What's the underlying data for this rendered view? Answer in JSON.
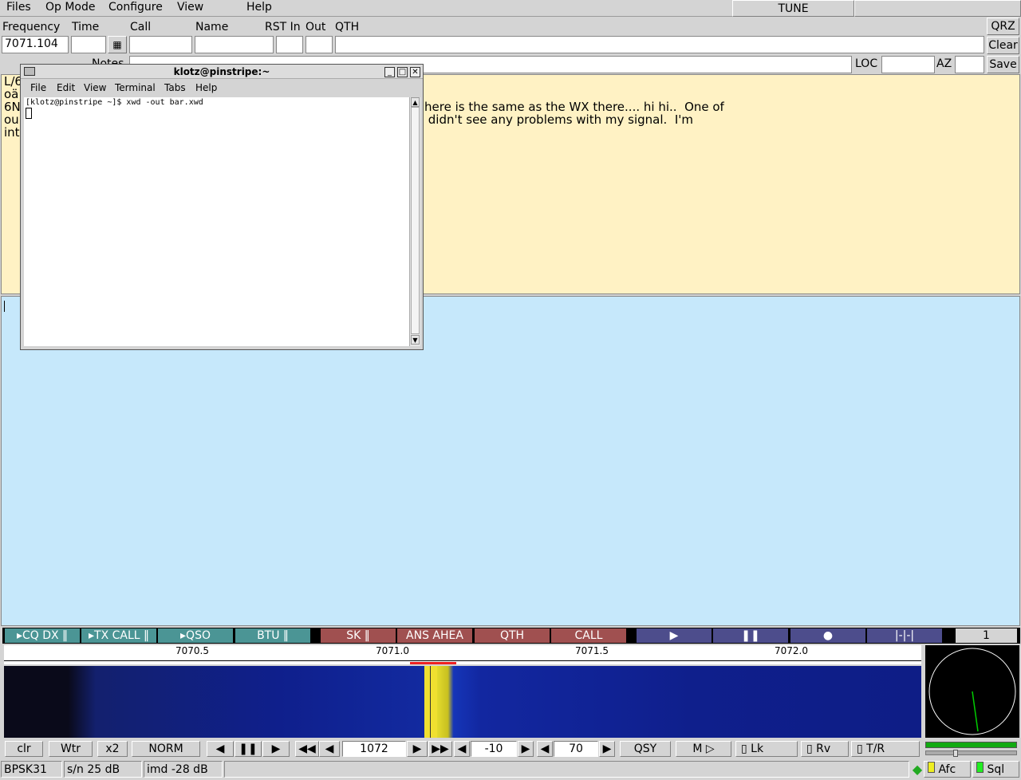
{
  "menubar": {
    "items": [
      "Files",
      "Op Mode",
      "Configure",
      "View",
      "Help"
    ],
    "tune": "TUNE"
  },
  "log": {
    "labels": {
      "frequency": "Frequency",
      "time": "Time",
      "call": "Call",
      "name": "Name",
      "rst_in": "RST In",
      "out": "Out",
      "qth": "QTH",
      "notes": "Notes",
      "loc": "LOC",
      "az": "AZ"
    },
    "frequency_value": "7071.104",
    "buttons": {
      "qrz": "QRZ",
      "clear": "Clear",
      "save": "Save"
    }
  },
  "rx_text": {
    "lines_left": [
      "L/6",
      "oä",
      "6N",
      "ou",
      "int"
    ],
    "line1": "here is the same as the WX there.... hi hi..  One of",
    "line2": " didn't see any problems with my signal.  I'm"
  },
  "terminal": {
    "title": "klotz@pinstripe:~",
    "menu": [
      "File",
      "Edit",
      "View",
      "Terminal",
      "Tabs",
      "Help"
    ],
    "prompt": "[klotz@pinstripe ~]$ xwd -out bar.xwd"
  },
  "macros": {
    "left": [
      "CQ DX",
      "TX CALL",
      "QSO",
      "BTU"
    ],
    "mid": [
      "SK",
      "ANS AHEA",
      "QTH",
      "CALL"
    ],
    "counter": "1"
  },
  "scale": {
    "ticks": [
      "7070.5",
      "7071.0",
      "7071.5",
      "7072.0"
    ]
  },
  "controls": {
    "clr": "clr",
    "wtr": "Wtr",
    "x2": "x2",
    "norm": "NORM",
    "freq": "1072",
    "level": "-10",
    "range": "70",
    "qsy": "QSY",
    "m": "M",
    "lk": "Lk",
    "rv": "Rv",
    "tr": "T/R"
  },
  "status": {
    "mode": "BPSK31",
    "sn": "s/n 25 dB",
    "imd": "imd -28 dB",
    "afc": "Afc",
    "sql": "Sql"
  },
  "colors": {
    "rx_bg": "#fff2c4",
    "tx_bg": "#c6e8fb",
    "waterfall_signal": "#e8e030"
  }
}
